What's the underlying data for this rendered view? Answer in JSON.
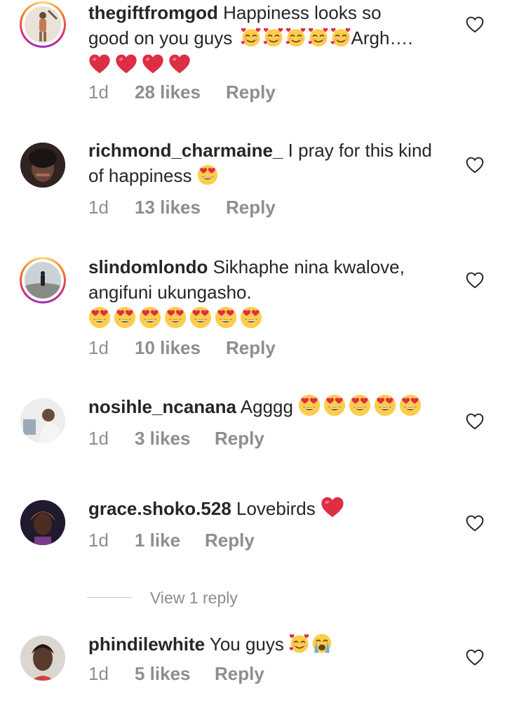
{
  "comments": [
    {
      "username": "thegiftfromgod",
      "text_line1": "Happiness looks so",
      "text_line2_pre": "good on you guys",
      "text_line2_post": "Argh….",
      "time": "1d",
      "likes": "28 likes",
      "reply": "Reply"
    },
    {
      "username": "richmond_charmaine_",
      "text_line1": "I pray for this kind",
      "text_line2": "of happiness",
      "time": "1d",
      "likes": "13 likes",
      "reply": "Reply"
    },
    {
      "username": "slindomlondo",
      "text_line1": "Sikhaphe nina kwalove,",
      "text_line2": "angifuni ukungasho.",
      "time": "1d",
      "likes": "10 likes",
      "reply": "Reply"
    },
    {
      "username": "nosihle_ncanana",
      "text_line1": "Agggg",
      "time": "1d",
      "likes": "3 likes",
      "reply": "Reply"
    },
    {
      "username": "grace.shoko.528",
      "text_line1": "Lovebirds",
      "time": "1d",
      "likes": "1 like",
      "reply": "Reply"
    },
    {
      "username": "phindilewhite",
      "text_line1": "You guys",
      "time": "1d",
      "likes": "5 likes",
      "reply": "Reply"
    }
  ],
  "view_replies": "View 1 reply",
  "colors": {
    "text": "#262626",
    "secondary": "#8e8e8e",
    "heart_red": "#ed4956",
    "emoji_yellow": "#ffcc4d"
  },
  "icons": [
    "like-heart-icon",
    "smiling-hearts-emoji",
    "heart-eyes-emoji",
    "red-heart-emoji",
    "crying-emoji"
  ]
}
